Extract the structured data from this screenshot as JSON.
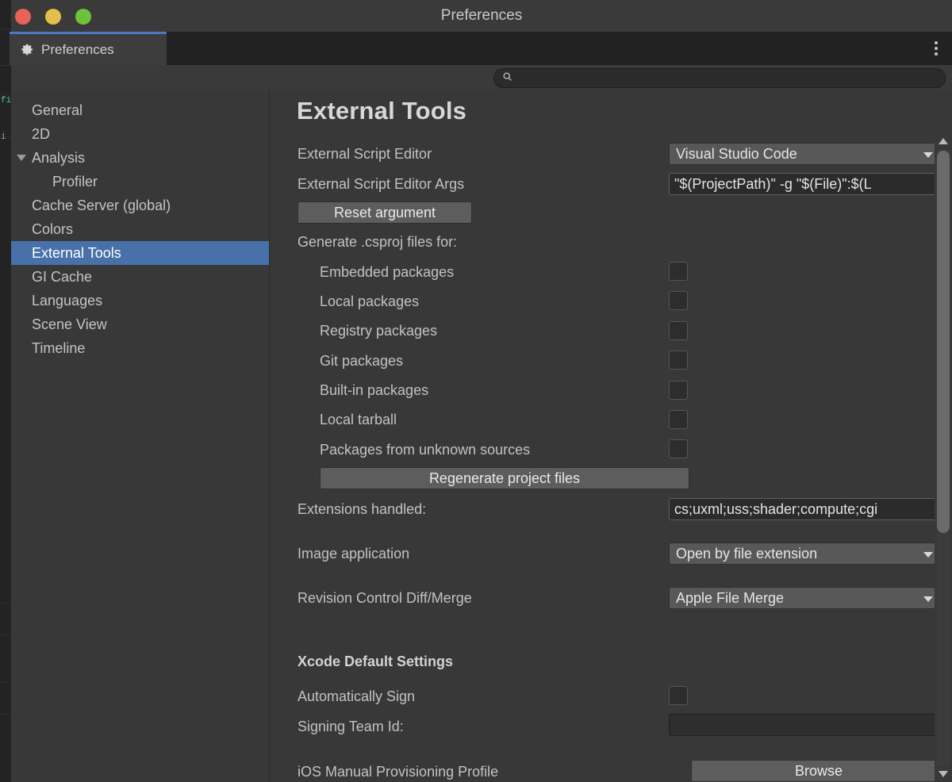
{
  "window": {
    "title": "Preferences",
    "traffic_lights": [
      {
        "name": "close",
        "color": "#e8625a"
      },
      {
        "name": "minimize",
        "color": "#e0c04a"
      },
      {
        "name": "zoom",
        "color": "#6fc03a"
      }
    ]
  },
  "tab": {
    "label": "Preferences",
    "icon": "gear-icon"
  },
  "overflow_menu": {
    "icon": "kebab-menu-icon"
  },
  "search": {
    "value": "",
    "placeholder": "",
    "icon": "search-icon"
  },
  "sidebar": {
    "items": [
      {
        "label": "General",
        "selected": false,
        "child": false,
        "expander": false
      },
      {
        "label": "2D",
        "selected": false,
        "child": false,
        "expander": false
      },
      {
        "label": "Analysis",
        "selected": false,
        "child": false,
        "expander": true
      },
      {
        "label": "Profiler",
        "selected": false,
        "child": true,
        "expander": false
      },
      {
        "label": "Cache Server (global)",
        "selected": false,
        "child": false,
        "expander": false
      },
      {
        "label": "Colors",
        "selected": false,
        "child": false,
        "expander": false
      },
      {
        "label": "External Tools",
        "selected": true,
        "child": false,
        "expander": false
      },
      {
        "label": "GI Cache",
        "selected": false,
        "child": false,
        "expander": false
      },
      {
        "label": "Languages",
        "selected": false,
        "child": false,
        "expander": false
      },
      {
        "label": "Scene View",
        "selected": false,
        "child": false,
        "expander": false
      },
      {
        "label": "Timeline",
        "selected": false,
        "child": false,
        "expander": false
      }
    ]
  },
  "main": {
    "title": "External Tools",
    "script_editor": {
      "label": "External Script Editor",
      "value": "Visual Studio Code"
    },
    "script_editor_args": {
      "label": "External Script Editor Args",
      "value": "\"$(ProjectPath)\" -g \"$(File)\":$(L"
    },
    "reset_argument_button": "Reset argument",
    "csproj": {
      "heading": "Generate .csproj files for:",
      "options": [
        {
          "label": "Embedded packages",
          "checked": false
        },
        {
          "label": "Local packages",
          "checked": false
        },
        {
          "label": "Registry packages",
          "checked": false
        },
        {
          "label": "Git packages",
          "checked": false
        },
        {
          "label": "Built-in packages",
          "checked": false
        },
        {
          "label": "Local tarball",
          "checked": false
        },
        {
          "label": "Packages from unknown sources",
          "checked": false
        }
      ]
    },
    "regenerate_button": "Regenerate project files",
    "extensions": {
      "label": "Extensions handled:",
      "value": "cs;uxml;uss;shader;compute;cgi"
    },
    "image_application": {
      "label": "Image application",
      "value": "Open by file extension"
    },
    "revision_control": {
      "label": "Revision Control Diff/Merge",
      "value": "Apple File Merge"
    },
    "xcode": {
      "heading": "Xcode Default Settings",
      "auto_sign": {
        "label": "Automatically Sign",
        "checked": false
      },
      "signing_team": {
        "label": "Signing Team Id:",
        "value": ""
      },
      "provisioning": {
        "label": "iOS Manual Provisioning Profile",
        "browse_button": "Browse"
      }
    }
  },
  "scrollbar": {
    "up_arrow": "scroll-up-arrow-icon",
    "down_arrow": "scroll-down-arrow-icon"
  },
  "colors": {
    "accent_selection": "#4771a8",
    "tab_accent": "#4a79c4",
    "panel_bg": "#383838",
    "tabstrip_bg": "#222222"
  }
}
